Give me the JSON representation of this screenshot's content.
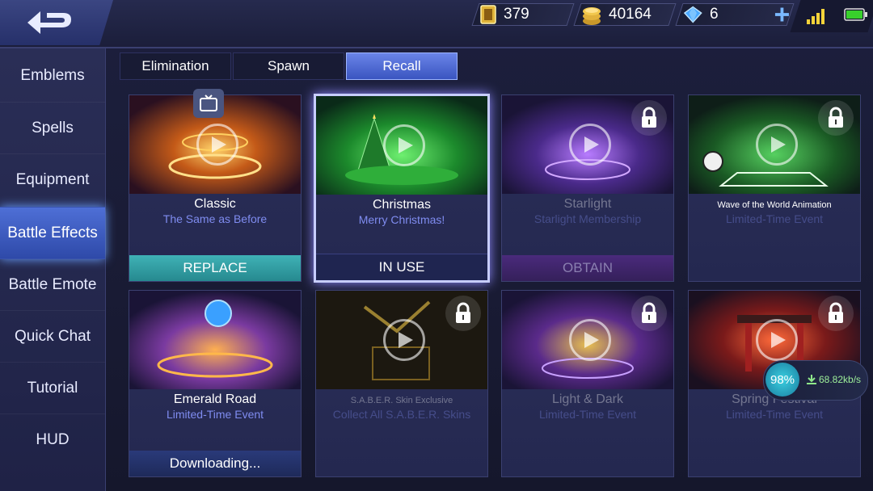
{
  "resources": {
    "tickets": "379",
    "gold": "40164",
    "diamonds": "6"
  },
  "sidebar": {
    "items": [
      {
        "label": "Emblems"
      },
      {
        "label": "Spells"
      },
      {
        "label": "Equipment"
      },
      {
        "label": "Battle Effects"
      },
      {
        "label": "Battle Emote"
      },
      {
        "label": "Quick Chat"
      },
      {
        "label": "Tutorial"
      },
      {
        "label": "HUD"
      }
    ],
    "active": "Battle Effects"
  },
  "tabs": [
    {
      "label": "Elimination"
    },
    {
      "label": "Spawn"
    },
    {
      "label": "Recall"
    }
  ],
  "active_tab": "Recall",
  "cards": [
    {
      "title": "Classic",
      "subtitle": "The Same as Before",
      "action": "REPLACE"
    },
    {
      "title": "Christmas",
      "subtitle": "Merry Christmas!",
      "action": "IN USE"
    },
    {
      "title": "Starlight",
      "subtitle": "Starlight Membership",
      "action": "OBTAIN"
    },
    {
      "title": "Wave of the World Animation",
      "subtitle": "Limited-Time Event"
    },
    {
      "title": "Emerald Road",
      "subtitle": "Limited-Time Event",
      "action": "Downloading..."
    },
    {
      "title": "S.A.B.E.R. Skin Exclusive",
      "subtitle": "Collect All S.A.B.E.R. Skins"
    },
    {
      "title": "Light & Dark",
      "subtitle": "Limited-Time Event"
    },
    {
      "title": "Spring Festival",
      "subtitle": "Limited-Time Event"
    }
  ],
  "download": {
    "percent": "98%",
    "speed": "68.82kb/s"
  },
  "colors": {
    "accent": "#3a55c0",
    "replace": "#2e9aa0",
    "subtitle": "#7f8cf0"
  }
}
